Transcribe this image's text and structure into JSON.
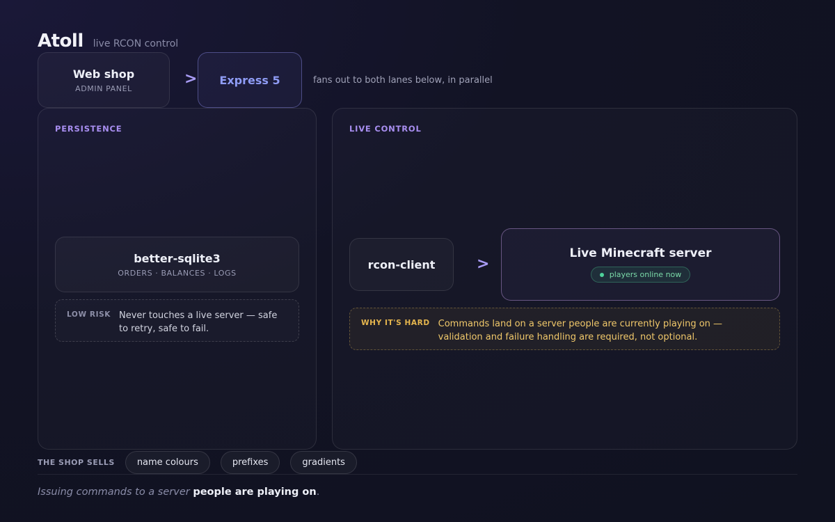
{
  "header": {
    "title": "Atoll",
    "subtitle": "live RCON control"
  },
  "flow": {
    "webshop": {
      "title": "Web shop",
      "sub": "ADMIN PANEL"
    },
    "express": {
      "title": "Express 5"
    },
    "fanout_note": "fans out to both lanes below, in parallel"
  },
  "lanes": {
    "persistence": {
      "label": "PERSISTENCE",
      "db": {
        "title": "better-sqlite3",
        "sub": "ORDERS · BALANCES · LOGS"
      },
      "note": {
        "tag": "LOW RISK",
        "text": "Never touches a live server — safe to retry, safe to fail."
      }
    },
    "live_control": {
      "label": "LIVE CONTROL",
      "client": {
        "title": "rcon-client"
      },
      "server": {
        "title": "Live Minecraft server",
        "badge": "players online now"
      },
      "note": {
        "tag": "WHY IT'S HARD",
        "text": "Commands land on a server people are currently playing on — validation and failure handling are required, not optional."
      }
    }
  },
  "sells": {
    "label": "THE SHOP SELLS",
    "items": [
      "name colours",
      "prefixes",
      "gradients"
    ]
  },
  "footer": {
    "italic": "Issuing commands to a server",
    "bold": "people are playing on",
    "end": "."
  },
  "icons": {
    "arrow": "chevron-right-icon",
    "status": "status-dot-icon"
  },
  "colors": {
    "accent": "#a88ef0",
    "link": "#8f9cf5",
    "ok": "#4ed29a",
    "warn": "#e6b64e"
  }
}
